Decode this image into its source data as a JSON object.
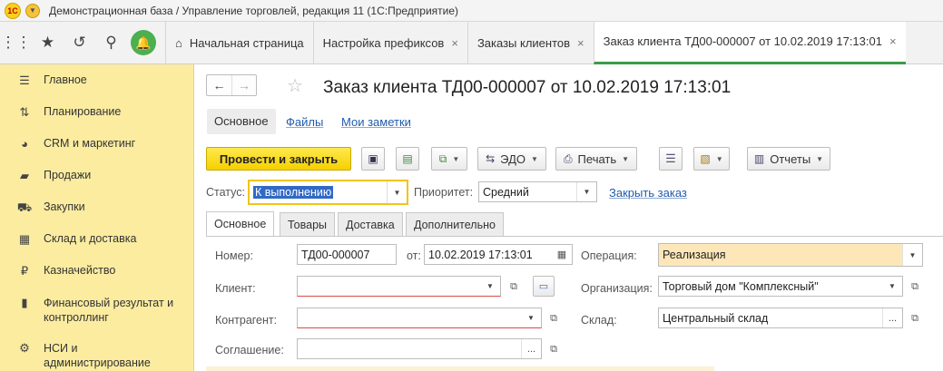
{
  "window": {
    "title": "Демонстрационная база / Управление торговлей, редакция 11  (1С:Предприятие)",
    "logo_text": "1С"
  },
  "topbar": {
    "tabs": [
      {
        "label": "Начальная страница",
        "closable": false
      },
      {
        "label": "Настройка префиксов",
        "closable": true
      },
      {
        "label": "Заказы клиентов",
        "closable": true
      },
      {
        "label": "Заказ клиента ТД00-000007 от 10.02.2019 17:13:01",
        "closable": true,
        "active": true
      }
    ],
    "close_glyph": "×"
  },
  "sidebar": {
    "items": [
      {
        "label": "Главное",
        "icon": "menu-icon"
      },
      {
        "label": "Планирование",
        "icon": "planning-icon"
      },
      {
        "label": "CRM и маркетинг",
        "icon": "pie-chart-icon"
      },
      {
        "label": "Продажи",
        "icon": "briefcase-icon"
      },
      {
        "label": "Закупки",
        "icon": "cart-icon"
      },
      {
        "label": "Склад и доставка",
        "icon": "warehouse-icon"
      },
      {
        "label": "Казначейство",
        "icon": "ruble-icon"
      },
      {
        "label": "Финансовый результат и контроллинг",
        "icon": "chart-icon"
      },
      {
        "label": "НСИ и администрирование",
        "icon": "gear-icon"
      }
    ]
  },
  "form": {
    "title": "Заказ клиента ТД00-000007 от 10.02.2019 17:13:01",
    "subtabs": {
      "main": "Основное",
      "files": "Файлы",
      "notes": "Мои заметки"
    },
    "toolbar": {
      "post_close": "Провести и закрыть",
      "edo": "ЭДО",
      "print": "Печать",
      "reports": "Отчеты"
    },
    "status": {
      "label": "Статус:",
      "value": "К выполнению"
    },
    "priority": {
      "label": "Приоритет:",
      "value": "Средний"
    },
    "close_order": "Закрыть заказ",
    "tabs": [
      "Основное",
      "Товары",
      "Доставка",
      "Дополнительно"
    ],
    "fields": {
      "number_label": "Номер:",
      "number_value": "ТД00-000007",
      "date_label": "от:",
      "date_value": "10.02.2019 17:13:01",
      "operation_label": "Операция:",
      "operation_value": "Реализация",
      "client_label": "Клиент:",
      "client_value": "",
      "org_label": "Организация:",
      "org_value": "Торговый дом \"Комплексный\"",
      "counterparty_label": "Контрагент:",
      "counterparty_value": "",
      "warehouse_label": "Склад:",
      "warehouse_value": "Центральный склад",
      "agreement_label": "Соглашение:",
      "agreement_value": ""
    }
  },
  "colors": {
    "sidebar_bg": "#fbeca0",
    "primary_button": "#f5d000",
    "active_tab_accent": "#3a9c4b",
    "link": "#1f5bb0",
    "operation_bg": "#fde7b8"
  }
}
